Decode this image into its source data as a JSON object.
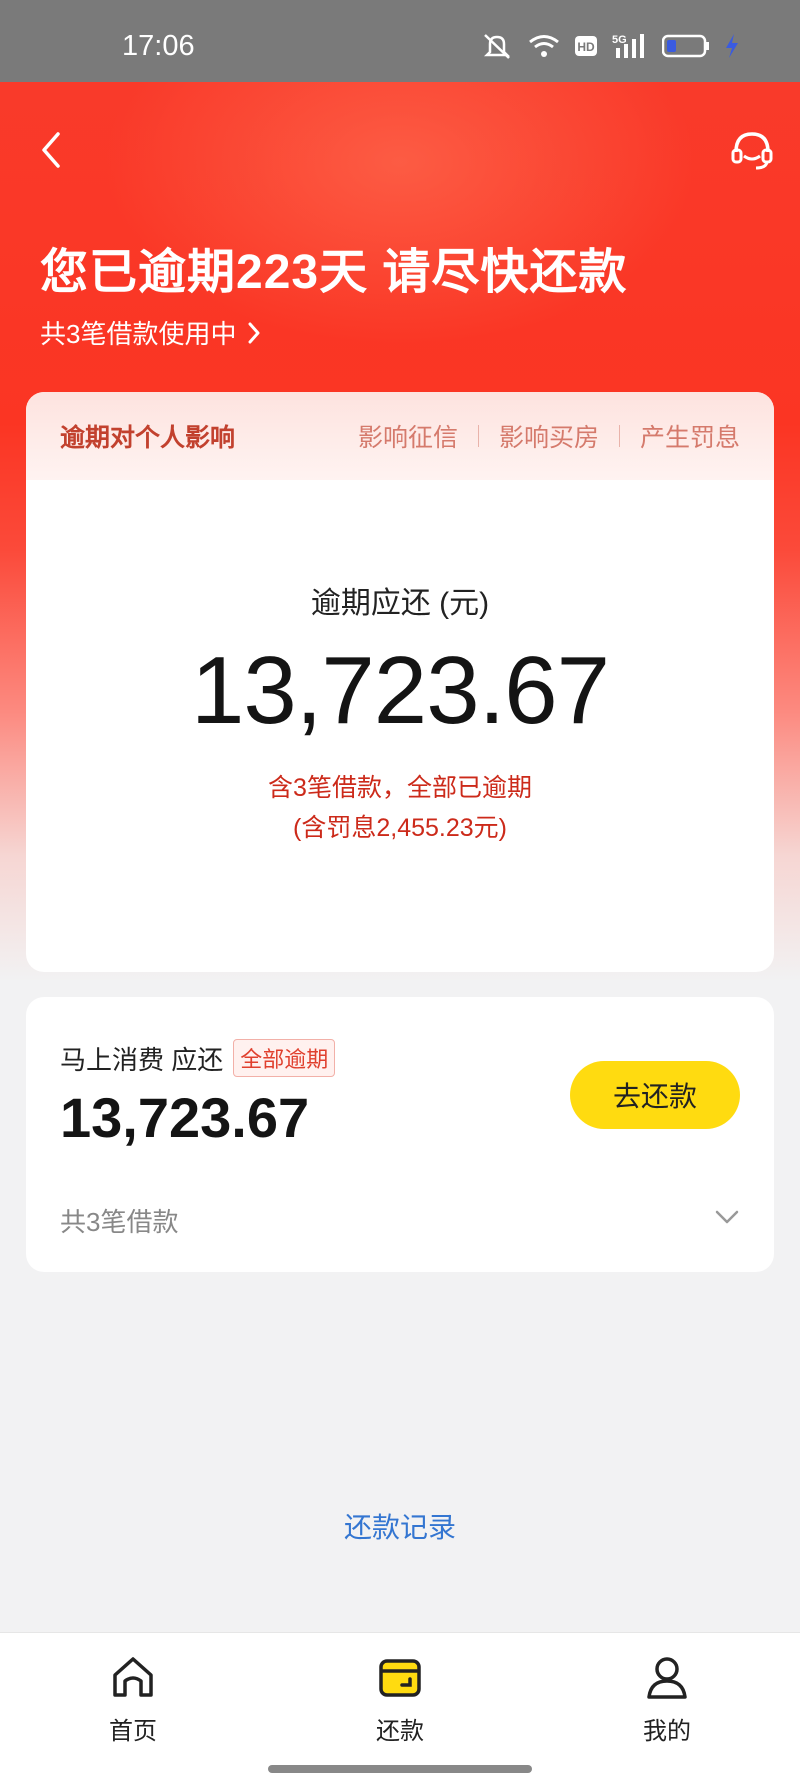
{
  "status_bar": {
    "time": "17:06",
    "icons": [
      "mute-icon",
      "wifi-icon",
      "hd-icon",
      "signal-5g-icon",
      "battery-icon",
      "charging-icon"
    ]
  },
  "header": {
    "title": "您已逾期223天 请尽快还款",
    "subtitle": "共3笔借款使用中"
  },
  "impact": {
    "title": "逾期对个人影响",
    "tags": [
      "影响征信",
      "影响买房",
      "产生罚息"
    ]
  },
  "summary": {
    "label": "逾期应还 (元)",
    "amount": "13,723.67",
    "note_line1": "含3笔借款，全部已逾期",
    "note_line2": "(含罚息2,455.23元)"
  },
  "loan_card": {
    "title": "马上消费 应还",
    "badge": "全部逾期",
    "amount": "13,723.67",
    "button_label": "去还款",
    "count_label": "共3笔借款"
  },
  "record_link": "还款记录",
  "tabs": [
    {
      "label": "首页",
      "icon": "home-icon"
    },
    {
      "label": "还款",
      "icon": "wallet-icon"
    },
    {
      "label": "我的",
      "icon": "user-icon"
    }
  ],
  "colors": {
    "hero_red": "#fb3523",
    "accent_yellow": "#ffdb10",
    "link_blue": "#3476d1",
    "overdue_red": "#cc2a1a"
  }
}
